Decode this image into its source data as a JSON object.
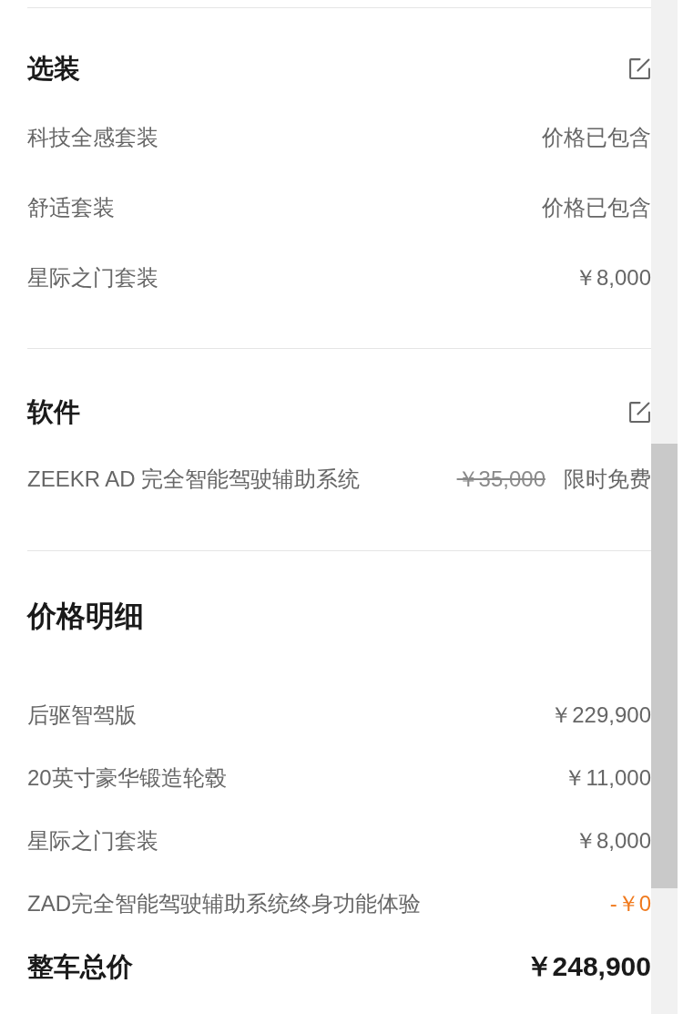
{
  "sections": [
    {
      "title": "选装",
      "editable": true,
      "rows": [
        {
          "label": "科技全感套装",
          "value": "价格已包含"
        },
        {
          "label": "舒适套装",
          "value": "价格已包含"
        },
        {
          "label": "星际之门套装",
          "value": "￥8,000"
        }
      ]
    },
    {
      "title": "软件",
      "editable": true,
      "rows": [
        {
          "label": "ZEEKR AD 完全智能驾驶辅助系统",
          "original_price": "￥35,000",
          "value": "限时免费"
        }
      ]
    }
  ],
  "price_breakdown": {
    "title": "价格明细",
    "rows": [
      {
        "kind": "item",
        "label": "后驱智驾版",
        "value": "￥229,900"
      },
      {
        "kind": "item",
        "label": "20英寸豪华锻造轮毂",
        "value": "￥11,000"
      },
      {
        "kind": "item",
        "label": "星际之门套装",
        "value": "￥8,000"
      },
      {
        "kind": "discount",
        "label": "ZAD完全智能驾驶辅助系统终身功能体验",
        "value": "-￥0"
      }
    ],
    "total": {
      "label": "整车总价",
      "value": "￥248,900"
    }
  }
}
